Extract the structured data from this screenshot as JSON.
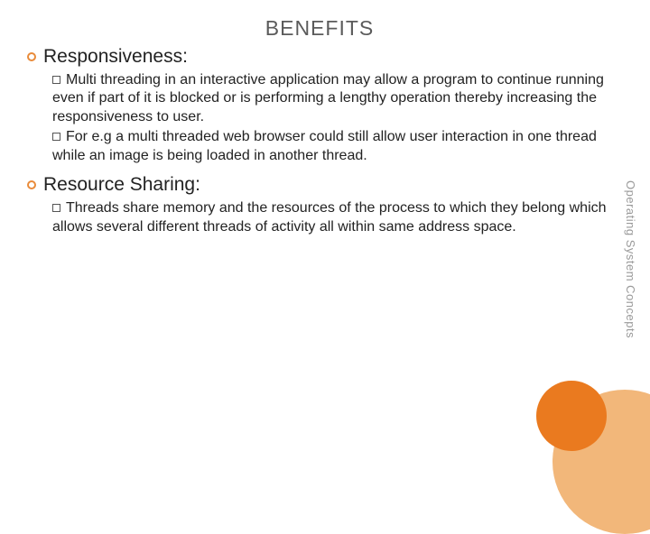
{
  "title": "BENEFITS",
  "sideLabel": "Operating System Concepts",
  "sections": [
    {
      "heading": "Responsiveness:",
      "items": [
        "Multi threading in an interactive application may allow a program to continue running even if part of it is blocked or is performing a lengthy operation thereby increasing the responsiveness to user.",
        "For e.g a multi threaded web browser could still allow user interaction in one thread while an image is being loaded in another thread."
      ]
    },
    {
      "heading": "Resource Sharing:",
      "items": [
        "Threads share memory and the resources of the process to which they belong which allows several different threads of activity all within same address space."
      ]
    }
  ]
}
